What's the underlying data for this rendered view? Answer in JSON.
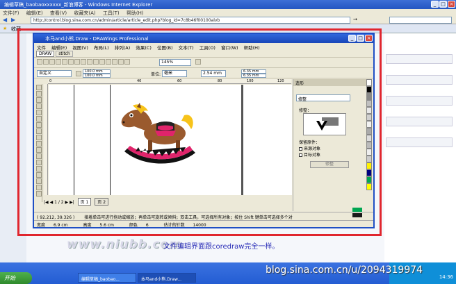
{
  "ie": {
    "title": "编辑草稿_baobaoxxxxxx_新浪博客 - Windows Internet Explorer",
    "menu": [
      "文件(F)",
      "编辑(E)",
      "查看(V)",
      "收藏夹(A)",
      "工具(T)",
      "帮助(H)"
    ],
    "address": "http://control.blog.sina.com.cn/admin/article/article_edit.php?blog_id=7c8b46f00100alvb",
    "tab_label": "收藏",
    "go_label": "→"
  },
  "coreldraw": {
    "title": "本马and小熊.Draw - DRAWings Professional",
    "menu": [
      "文件",
      "编辑(E)",
      "视图(V)",
      "布局(L)",
      "排列(A)",
      "效果(C)",
      "位图(B)",
      "文本(T)",
      "工具(O)",
      "窗口(W)",
      "帮助(H)"
    ],
    "doc_tabs": [
      "DRAW",
      "stitch"
    ],
    "page_size_preset": "自定义",
    "width": "100.0 mm",
    "height": "100.0 mm",
    "unit_label": "单位:",
    "unit": "毫米",
    "nudge": "2.54 mm",
    "dup_x": "6.35 mm",
    "dup_y": "6.35 mm",
    "zoom": "145%",
    "ruler_marks": [
      "0",
      "40",
      "60",
      "80",
      "100",
      "120"
    ],
    "page_counter": "1 / 2",
    "pages": [
      "页 1",
      "页 2"
    ],
    "docker": {
      "title": "造形",
      "mode": "修整",
      "section": "修整：",
      "keep_label": "保留原件：",
      "option_source": "来源对象",
      "option_target": "目标对象",
      "apply_button": "修整"
    },
    "status": {
      "coords": "( 92.212, 39.326 )",
      "hint": "接着单击可进行拖动或缩放；再单击可旋转或倾斜；双击工具，可选择所有对象；按住 Shift 键单击可选择多个对",
      "width_label": "宽度",
      "width_value": "6.9 cm",
      "height_label": "高度",
      "height_value": "5.6 cm",
      "colors_label": "颜色",
      "colors_value": "6",
      "stitches_label": "估计的针数",
      "stitches_value": "14000"
    }
  },
  "caption": "文件编辑界面跟coredraw完全一样。",
  "site_watermark": "www.niubb.com",
  "blog_watermark": "blog.sina.com.cn/u/2094319974",
  "taskbar": {
    "start": "开始",
    "buttons": [
      "编辑草稿_baobao...",
      "本马and小熊.Draw..."
    ],
    "clock": "14:36"
  },
  "palette_colors": [
    "#ffffff",
    "#000000",
    "#888888",
    "#c0c0c0",
    "#e8e8e8",
    "#d0d0d0",
    "#f2f2f2",
    "#aaaaaa",
    "#dddddd",
    "#bbbbbb",
    "#eeeeee",
    "#cccccc",
    "#fff200",
    "#000080",
    "#00a651",
    "#ffff00"
  ],
  "status_swatches": [
    "#00a651",
    "#1a1a1a"
  ]
}
